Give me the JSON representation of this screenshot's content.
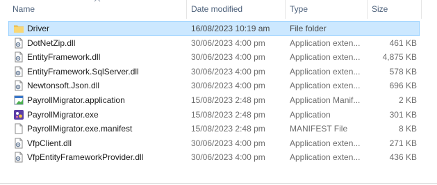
{
  "columns": {
    "name": "Name",
    "date": "Date modified",
    "type": "Type",
    "size": "Size"
  },
  "files": [
    {
      "name": "Driver",
      "date": "16/08/2023 10:19 am",
      "type": "File folder",
      "size": "",
      "icon": "folder-icon",
      "selected": true
    },
    {
      "name": "DotNetZip.dll",
      "date": "30/06/2023 4:00 pm",
      "type": "Application exten...",
      "size": "461 KB",
      "icon": "dll-file-icon"
    },
    {
      "name": "EntityFramework.dll",
      "date": "30/06/2023 4:00 pm",
      "type": "Application exten...",
      "size": "4,875 KB",
      "icon": "dll-file-icon"
    },
    {
      "name": "EntityFramework.SqlServer.dll",
      "date": "30/06/2023 4:00 pm",
      "type": "Application exten...",
      "size": "578 KB",
      "icon": "dll-file-icon"
    },
    {
      "name": "Newtonsoft.Json.dll",
      "date": "30/06/2023 4:00 pm",
      "type": "Application exten...",
      "size": "696 KB",
      "icon": "dll-file-icon"
    },
    {
      "name": "PayrollMigrator.application",
      "date": "15/08/2023 2:48 pm",
      "type": "Application Manif...",
      "size": "2 KB",
      "icon": "application-manifest-icon"
    },
    {
      "name": "PayrollMigrator.exe",
      "date": "15/08/2023 2:48 pm",
      "type": "Application",
      "size": "301 KB",
      "icon": "exe-app-icon"
    },
    {
      "name": "PayrollMigrator.exe.manifest",
      "date": "15/08/2023 2:48 pm",
      "type": "MANIFEST File",
      "size": "8 KB",
      "icon": "blank-file-icon"
    },
    {
      "name": "VfpClient.dll",
      "date": "30/06/2023 4:00 pm",
      "type": "Application exten...",
      "size": "271 KB",
      "icon": "dll-file-icon"
    },
    {
      "name": "VfpEntityFrameworkProvider.dll",
      "date": "30/06/2023 4:00 pm",
      "type": "Application exten...",
      "size": "436 KB",
      "icon": "dll-file-icon"
    }
  ],
  "colors": {
    "selection": "#cce8ff",
    "selection_border": "#99d1ff",
    "folder": "#f8d775",
    "header_text": "#4c607a"
  }
}
